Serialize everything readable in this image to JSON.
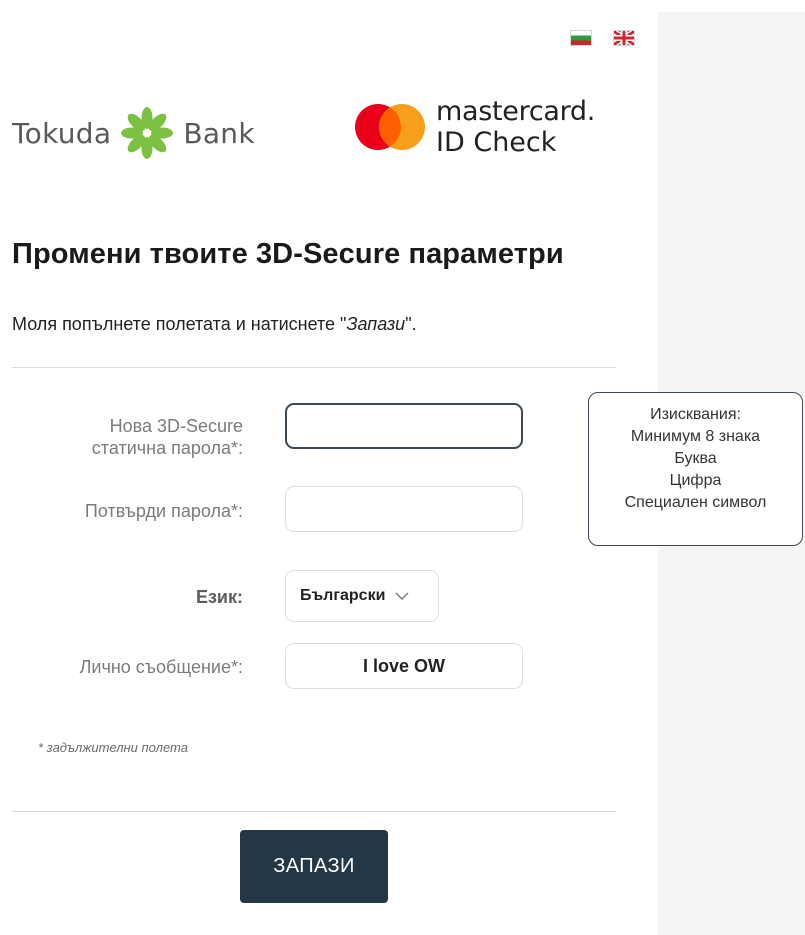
{
  "languages": {
    "bulgarian_flag": "flag-bg-icon",
    "english_flag": "flag-uk-icon"
  },
  "bank_logo": {
    "word_left": "Tokuda",
    "word_right": "Bank",
    "icon": "flower-icon",
    "color": "#7cc142"
  },
  "scheme_logo": {
    "name": "mastercard.",
    "sub": "ID Check",
    "colors": {
      "red": "#eb001b",
      "yellow": "#f79e1b",
      "overlap": "#ff5f00"
    }
  },
  "page": {
    "title": "Промени твоите 3D-Secure параметри",
    "instructions_prefix": "Моля попълнете полетата и натиснете \"",
    "instructions_emphasis": "Запази",
    "instructions_suffix": "\"."
  },
  "form": {
    "new_password_label_line1": "Нова 3D-Secure",
    "new_password_label_line2": "статична парола*:",
    "new_password_value": "",
    "confirm_password_label": "Потвърди парола*:",
    "confirm_password_value": "",
    "language_label": "Език:",
    "language_selected": "Български",
    "message_label": "Лично съобщение*:",
    "message_value": "I love OW",
    "required_note": "* задължителни полета",
    "save_label": "ЗАПАЗИ"
  },
  "requirements": {
    "title": "Изисквания:",
    "items": [
      "Минимум 8 знака",
      "Буква",
      "Цифра",
      "Специален символ"
    ]
  },
  "colors": {
    "button": "#243746",
    "active_border": "#3d4a55",
    "side_panel": "#f5f5f6"
  }
}
